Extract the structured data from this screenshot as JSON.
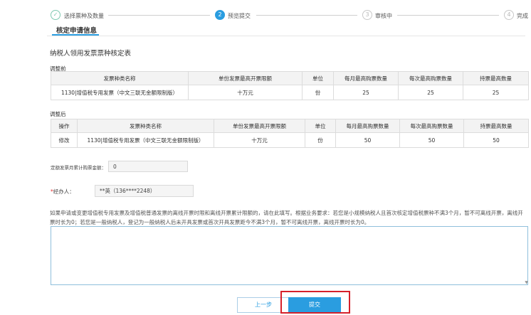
{
  "steps": [
    {
      "number": "✓",
      "label": "选择票种及数量",
      "state": "done"
    },
    {
      "number": "2",
      "label": "预览提交",
      "state": "active"
    },
    {
      "number": "3",
      "label": "审核中",
      "state": "todo"
    },
    {
      "number": "4",
      "label": "完成",
      "state": "todo"
    }
  ],
  "tab": {
    "label": "核定申请信息"
  },
  "form_title": "纳税人领用发票票种核定表",
  "before": {
    "section_label": "调整前",
    "headers": [
      "发票种类名称",
      "单份发票最高开票限额",
      "单位",
      "每月最高购票数量",
      "每次最高购票数量",
      "持票最高数量"
    ],
    "rows": [
      [
        "1130|增值税专用发票（中文三联无金额限制版）",
        "十万元",
        "份",
        "25",
        "25",
        "25"
      ]
    ]
  },
  "after": {
    "section_label": "调整后",
    "headers": [
      "操作",
      "发票种类名称",
      "单份发票最高开票限额",
      "单位",
      "每月最高购票数量",
      "每次最高购票数量",
      "持票最高数量"
    ],
    "rows": [
      [
        "修改",
        "1130|增值税专用发票（中文三联无金额限制版）",
        "十万元",
        "份",
        "50",
        "50",
        "50"
      ]
    ]
  },
  "fields": {
    "monthly_total": {
      "label": "定额发票月累计购票金额：",
      "value": "0"
    },
    "handler": {
      "required_mark": "*",
      "label": "经办人：",
      "value": "**英（136****2248）"
    }
  },
  "notice": "如果申请或变更增值税专用发票及增值税普通发票的离线开票时限和离线开票累计限额的，请在此填写。根据业务要求：若您是小规模纳税人且首次核定增值税票种不满3个月，暂不可离线开票，离线开票时长为0；若您是一般纳税人，登记为一般纳税人后未开具发票或首次开具发票距今不满3个月，暂不可离线开票，离线开票时长为0。",
  "notes_value": "",
  "buttons": {
    "prev": "上一步",
    "submit": "提交"
  },
  "colors": {
    "accent": "#2a9de0",
    "done": "#7ec9b1",
    "highlight": "#d6202a"
  }
}
